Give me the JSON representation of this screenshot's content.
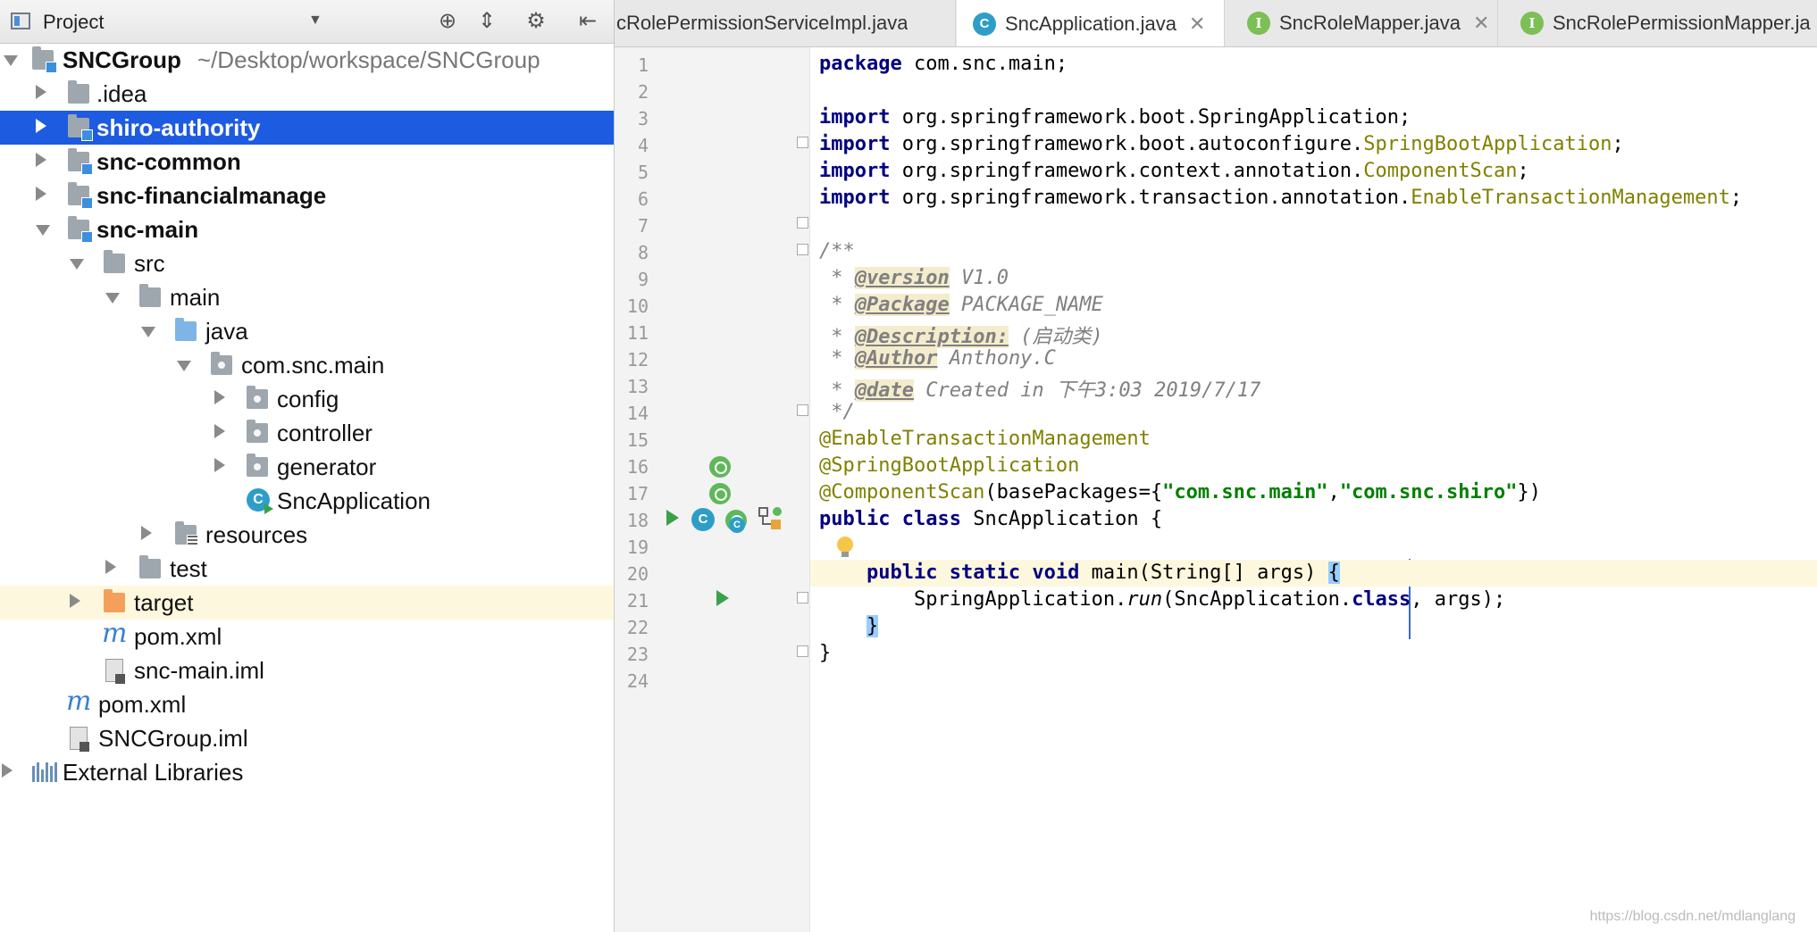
{
  "project_panel": {
    "title": "Project",
    "caret": "▼",
    "tools": [
      {
        "name": "locate-icon",
        "glyph": "⊕"
      },
      {
        "name": "collapse-all-icon",
        "glyph": "⇕"
      },
      {
        "name": "gear-icon",
        "glyph": "⚙"
      },
      {
        "name": "hide-icon",
        "glyph": "⇤"
      }
    ],
    "tree": [
      {
        "label": "SNCGroup",
        "path": "~/Desktop/workspace/SNCGroup"
      },
      {
        "label": ".idea"
      },
      {
        "label": "shiro-authority"
      },
      {
        "label": "snc-common"
      },
      {
        "label": "snc-financialmanage"
      },
      {
        "label": "snc-main"
      },
      {
        "label": "src"
      },
      {
        "label": "main"
      },
      {
        "label": "java"
      },
      {
        "label": "com.snc.main"
      },
      {
        "label": "config"
      },
      {
        "label": "controller"
      },
      {
        "label": "generator"
      },
      {
        "label": "SncApplication"
      },
      {
        "label": "resources"
      },
      {
        "label": "test"
      },
      {
        "label": "target"
      },
      {
        "label": "pom.xml"
      },
      {
        "label": "snc-main.iml"
      },
      {
        "label": "pom.xml"
      },
      {
        "label": "SNCGroup.iml"
      },
      {
        "label": "External Libraries"
      }
    ],
    "icon_glyphs": {
      "maven": "m",
      "class": "C"
    }
  },
  "editor": {
    "tabs": [
      {
        "label": "cRolePermissionServiceImpl.java",
        "icon": "class-icon"
      },
      {
        "label": "SncApplication.java",
        "icon": "class-icon",
        "glyph": "C"
      },
      {
        "label": "SncRoleMapper.java",
        "icon": "interface-icon",
        "glyph": "I"
      },
      {
        "label": "SncRolePermissionMapper.ja",
        "icon": "interface-icon",
        "glyph": "I"
      }
    ],
    "tab_close": "✕",
    "line_numbers": [
      "1",
      "2",
      "3",
      "4",
      "5",
      "6",
      "7",
      "8",
      "9",
      "10",
      "11",
      "12",
      "13",
      "14",
      "15",
      "16",
      "17",
      "18",
      "19",
      "20",
      "21",
      "22",
      "23",
      "24"
    ],
    "gutter_glyph": "C",
    "code": {
      "l1": {
        "kw": "package",
        "rest": " com.snc.main;"
      },
      "l3": {
        "kw": "import",
        "rest": " org.springframework.boot.SpringApplication;"
      },
      "l4": {
        "kw": "import",
        "rest": " org.springframework.boot.autoconfigure.",
        "ann": "SpringBootApplication",
        "end": ";"
      },
      "l5": {
        "kw": "import",
        "rest": " org.springframework.context.annotation.",
        "ann": "ComponentScan",
        "end": ";"
      },
      "l6": {
        "kw": "import",
        "rest": " org.springframework.transaction.annotation.",
        "ann": "EnableTransactionManagement",
        "end": ";"
      },
      "l8": "/**",
      "l9": {
        "star": " * ",
        "tag": "@version",
        "rest": " V1.0"
      },
      "l10": {
        "star": " * ",
        "tag": "@Package",
        "rest": " PACKAGE_NAME"
      },
      "l11": {
        "star": " * ",
        "tag": "@Description:",
        "rest": " (启动类)"
      },
      "l12": {
        "star": " * ",
        "tag": "@Author",
        "rest": " Anthony.C"
      },
      "l13": {
        "star": " * ",
        "tag": "@date",
        "rest": " Created in 下午3:03 2019/7/17"
      },
      "l14": " */",
      "l15": "@EnableTransactionManagement",
      "l16": "@SpringBootApplication",
      "l17": {
        "ann": "@ComponentScan",
        "a": "(basePackages={",
        "s1": "\"com.snc.main\"",
        "comma": ",",
        "s2": "\"com.snc.shiro\"",
        "b": "})"
      },
      "l18": {
        "kw": "public class",
        "rest": " SncApplication {"
      },
      "l20": {
        "indent": "    ",
        "kw": "public static void",
        "rest": " main(String[] args) ",
        "brace": "{"
      },
      "l21": {
        "indent": "        ",
        "pre": "SpringApplication.",
        "mth": "run",
        "mid": "(SncApplication.",
        "kw": "class",
        "end": ", args);"
      },
      "l22": {
        "indent": "    ",
        "brace": "}"
      },
      "l23": "}"
    }
  },
  "watermark": "https://blog.csdn.net/mdlanglang"
}
